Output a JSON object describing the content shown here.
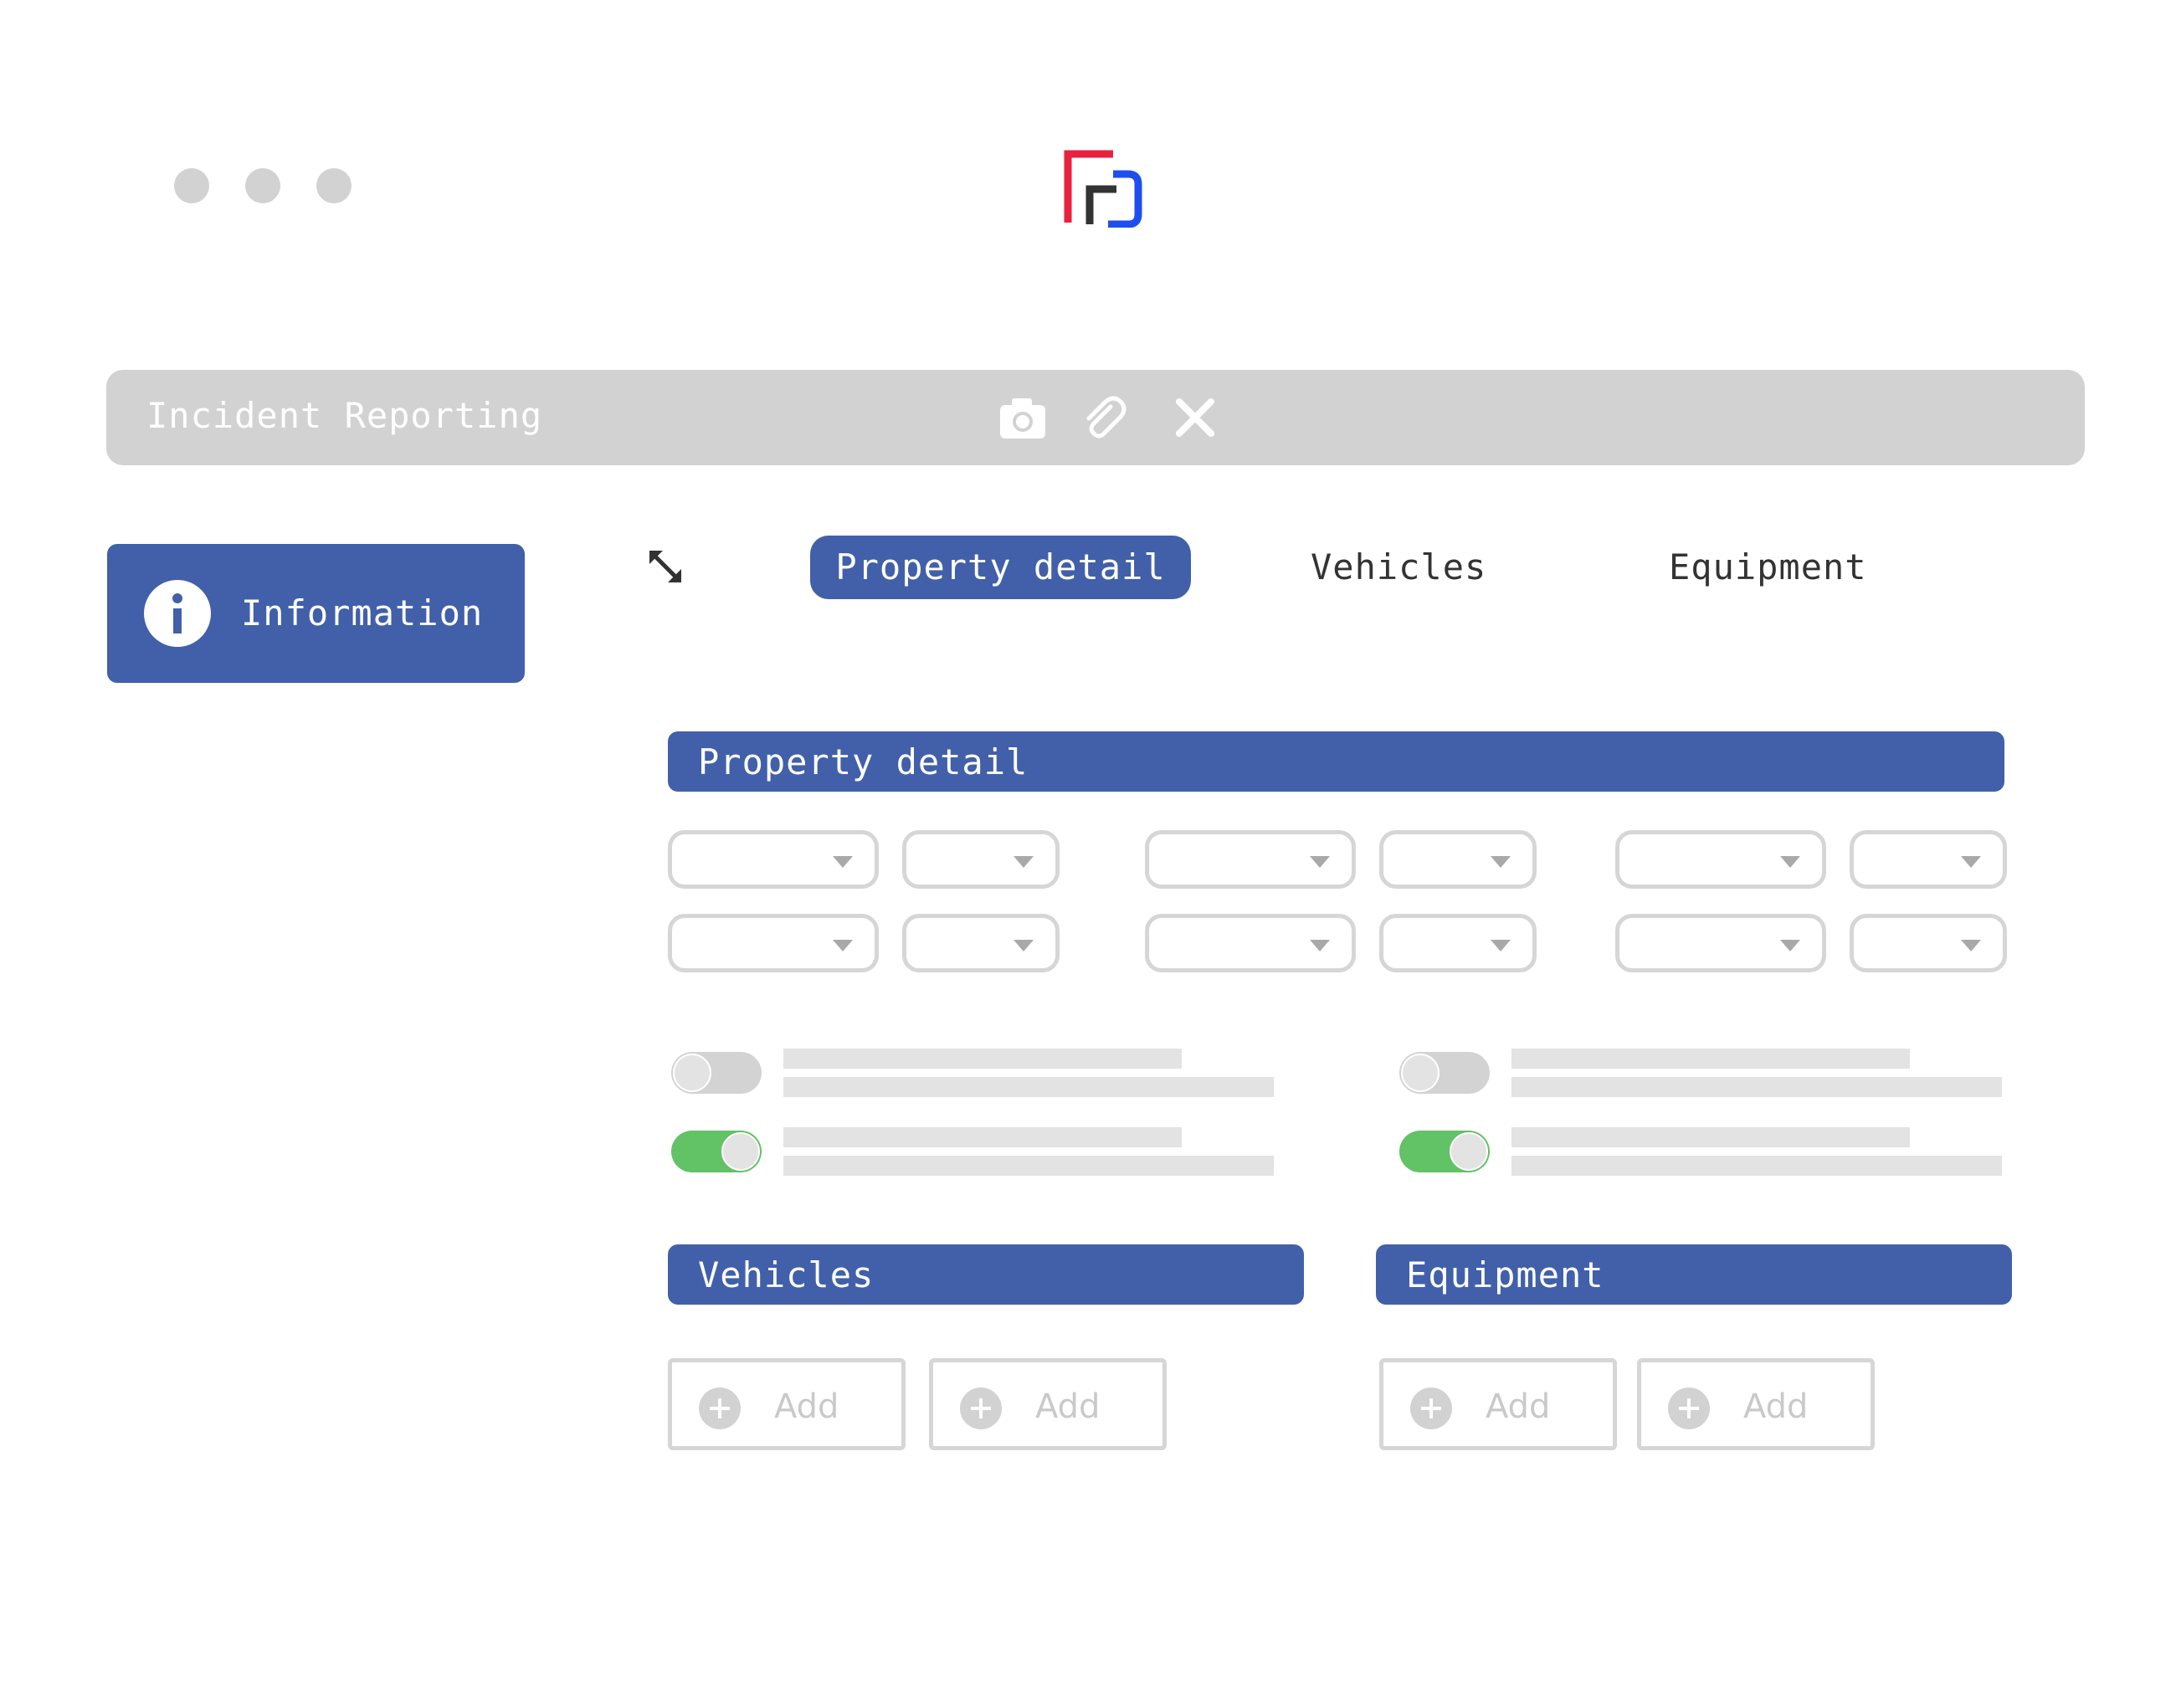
{
  "window": {
    "dots": [
      "dot",
      "dot",
      "dot"
    ]
  },
  "logo": {
    "name": "brand-logo",
    "colors": {
      "red": "#e8213e",
      "blue": "#1f4ef0",
      "dark": "#333333"
    }
  },
  "titlebar": {
    "title": "Incident Reporting",
    "icons": [
      "camera-icon",
      "paperclip-icon",
      "close-icon"
    ]
  },
  "sidebar": {
    "items": [
      {
        "label": "Information",
        "icon": "info-icon",
        "active": true
      }
    ]
  },
  "tabs": [
    {
      "label": "Property detail",
      "active": true
    },
    {
      "label": "Vehicles",
      "active": false
    },
    {
      "label": "Equipment",
      "active": false
    }
  ],
  "sections": {
    "property": {
      "title": "Property detail"
    },
    "vehicles": {
      "title": "Vehicles",
      "add_labels": [
        "Add",
        "Add"
      ]
    },
    "equipment": {
      "title": "Equipment",
      "add_labels": [
        "Add",
        "Add"
      ]
    }
  },
  "toggles": [
    {
      "on": false
    },
    {
      "on": false
    },
    {
      "on": true
    },
    {
      "on": true
    }
  ],
  "colors": {
    "accent": "#4260a9",
    "toggle_on": "#62c266",
    "titlebar": "#d3d2d3",
    "placeholder": "#e3e3e3"
  }
}
